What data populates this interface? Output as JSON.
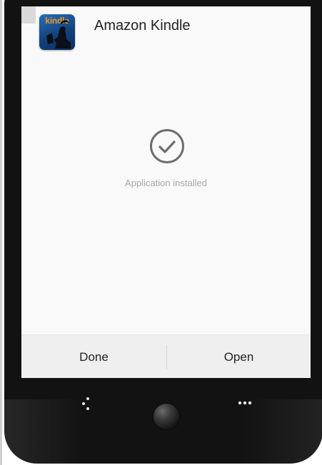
{
  "app": {
    "name": "Amazon Kindle",
    "icon_text": "kindle",
    "icon_name": "kindle-app-icon"
  },
  "install": {
    "status": "Application installed",
    "status_icon": "check-circle-icon"
  },
  "buttons": {
    "done": "Done",
    "open": "Open"
  },
  "device_nav": {
    "back_icon": "back-icon",
    "home_icon": "home-button",
    "menu_icon": "menu-dots-icon"
  },
  "colors": {
    "screen_bg": "#f9f9f9",
    "button_bar_bg": "#efefef",
    "device_body": "#121212",
    "kindle_orange": "#f39a21",
    "kindle_blue": "#12427d"
  }
}
